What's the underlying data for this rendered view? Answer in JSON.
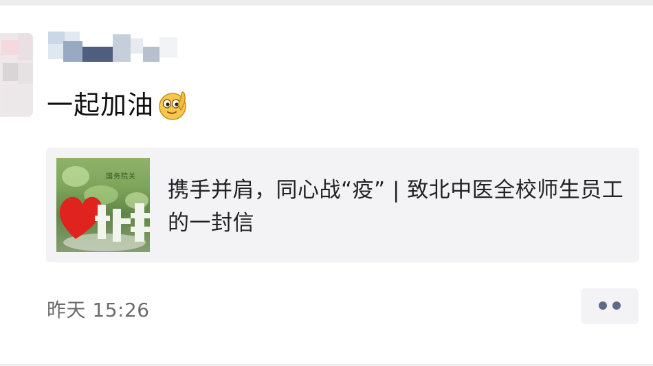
{
  "post": {
    "text": "一起加油",
    "emoji": "smiling-face-emoji",
    "link": {
      "title": "携手并肩，同心战“疫” | 致北中医全校师生员工的一封信",
      "thumbnail_caption": "国务院关"
    },
    "timestamp": "昨天 15:26"
  },
  "icons": {
    "more": "more-dots-icon"
  },
  "colors": {
    "background": "#ffffff",
    "card_bg": "#f3f3f5",
    "text_primary": "#111111",
    "text_secondary": "#6b6b6b",
    "dots": "#5f6b85",
    "emoji_face": "#f7c64a"
  }
}
